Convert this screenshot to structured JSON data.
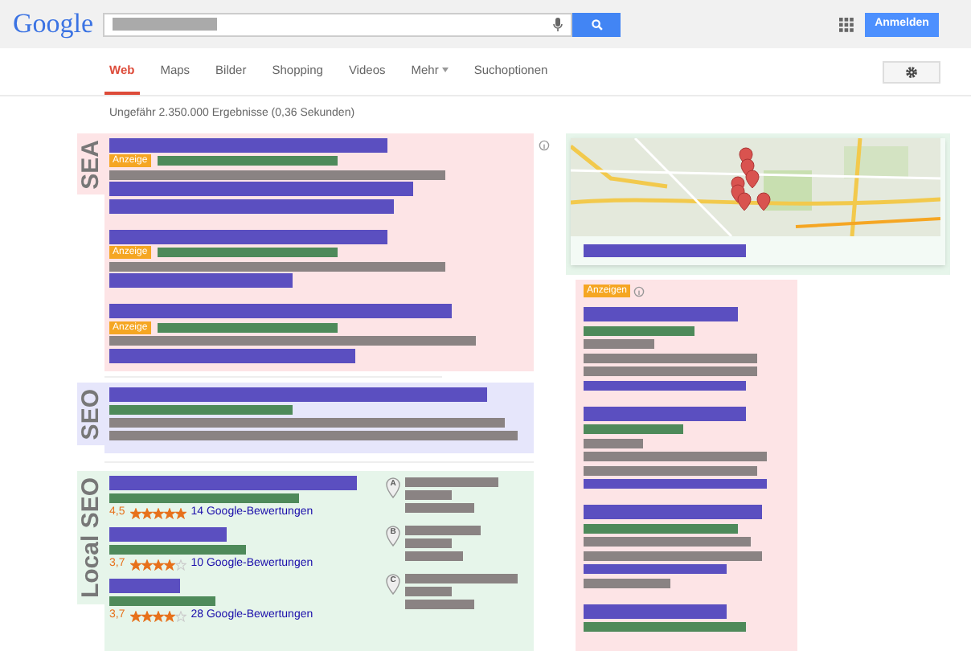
{
  "header": {
    "logo": "Google",
    "sign_in": "Anmelden"
  },
  "tabs": [
    {
      "label": "Web",
      "selected": true
    },
    {
      "label": "Maps",
      "selected": false
    },
    {
      "label": "Bilder",
      "selected": false
    },
    {
      "label": "Shopping",
      "selected": false
    },
    {
      "label": "Videos",
      "selected": false
    },
    {
      "label": "Mehr",
      "selected": false,
      "kind": "menu"
    },
    {
      "label": "Suchoptionen",
      "selected": false
    }
  ],
  "result_count": "Ungefähr 2.350.000 Ergebnisse (0,36 Sekunden)",
  "sections": [
    {
      "label": "SEA",
      "kind": "ads",
      "badges": [
        "Anzeige",
        "Anzeige",
        "Anzeige"
      ]
    },
    {
      "label": "SEO",
      "kind": "organic"
    },
    {
      "label": "Local SEO",
      "kind": "local",
      "places": [
        {
          "rating": "4,5",
          "stars": 5,
          "reviews": "14 Google-Bewertungen",
          "pin": "A"
        },
        {
          "rating": "3,7",
          "stars": 4,
          "reviews": "10 Google-Bewertungen",
          "pin": "B"
        },
        {
          "rating": "3,7",
          "stars": 4,
          "reviews": "28 Google-Bewertungen",
          "pin": "C"
        }
      ]
    }
  ],
  "side_ads": {
    "badge": "Anzeigen"
  }
}
